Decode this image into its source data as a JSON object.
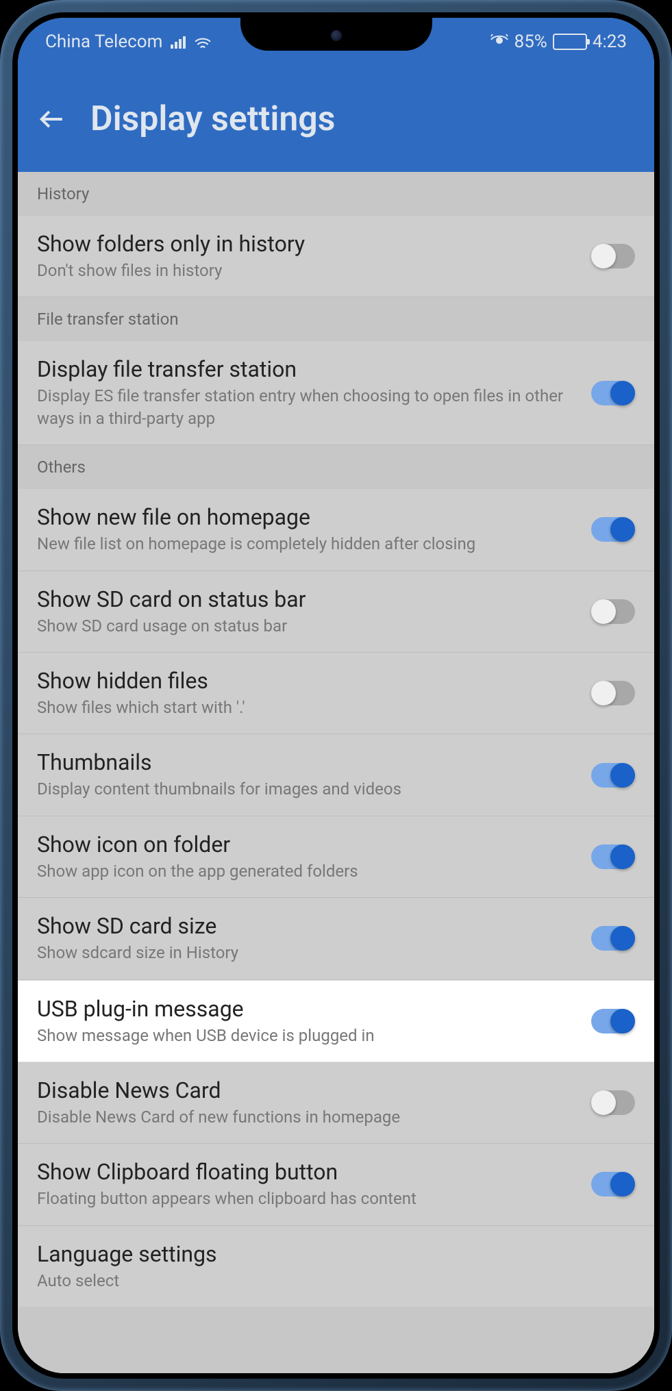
{
  "status": {
    "carrier": "China Telecom",
    "battery_pct": "85%",
    "time": "4:23"
  },
  "header": {
    "title": "Display settings"
  },
  "sections": {
    "history": {
      "label": "History",
      "items": [
        {
          "title": "Show folders only in history",
          "sub": "Don't show files in history",
          "on": false
        }
      ]
    },
    "file_transfer": {
      "label": "File transfer station",
      "items": [
        {
          "title": "Display file transfer station",
          "sub": "Display ES file transfer station entry when choosing to open files in other ways in a third-party app",
          "on": true
        }
      ]
    },
    "others": {
      "label": "Others",
      "items": [
        {
          "title": "Show new file on homepage",
          "sub": "New file list on homepage is completely hidden after closing",
          "on": true
        },
        {
          "title": "Show SD card on status bar",
          "sub": "Show SD card usage on status bar",
          "on": false
        },
        {
          "title": "Show hidden files",
          "sub": "Show files which start with '.'",
          "on": false
        },
        {
          "title": "Thumbnails",
          "sub": "Display content thumbnails for images and videos",
          "on": true
        },
        {
          "title": "Show icon on folder",
          "sub": "Show app icon on the app generated folders",
          "on": true
        },
        {
          "title": "Show SD card size",
          "sub": "Show sdcard size in History",
          "on": true
        },
        {
          "title": "USB plug-in message",
          "sub": "Show message when USB device is plugged in",
          "on": true,
          "highlight": true
        },
        {
          "title": "Disable News Card",
          "sub": "Disable News Card of new functions in homepage",
          "on": false
        },
        {
          "title": "Show Clipboard floating button",
          "sub": "Floating button appears when clipboard has content",
          "on": true
        },
        {
          "title": "Language settings",
          "sub": "Auto select",
          "toggle": false
        }
      ]
    }
  }
}
